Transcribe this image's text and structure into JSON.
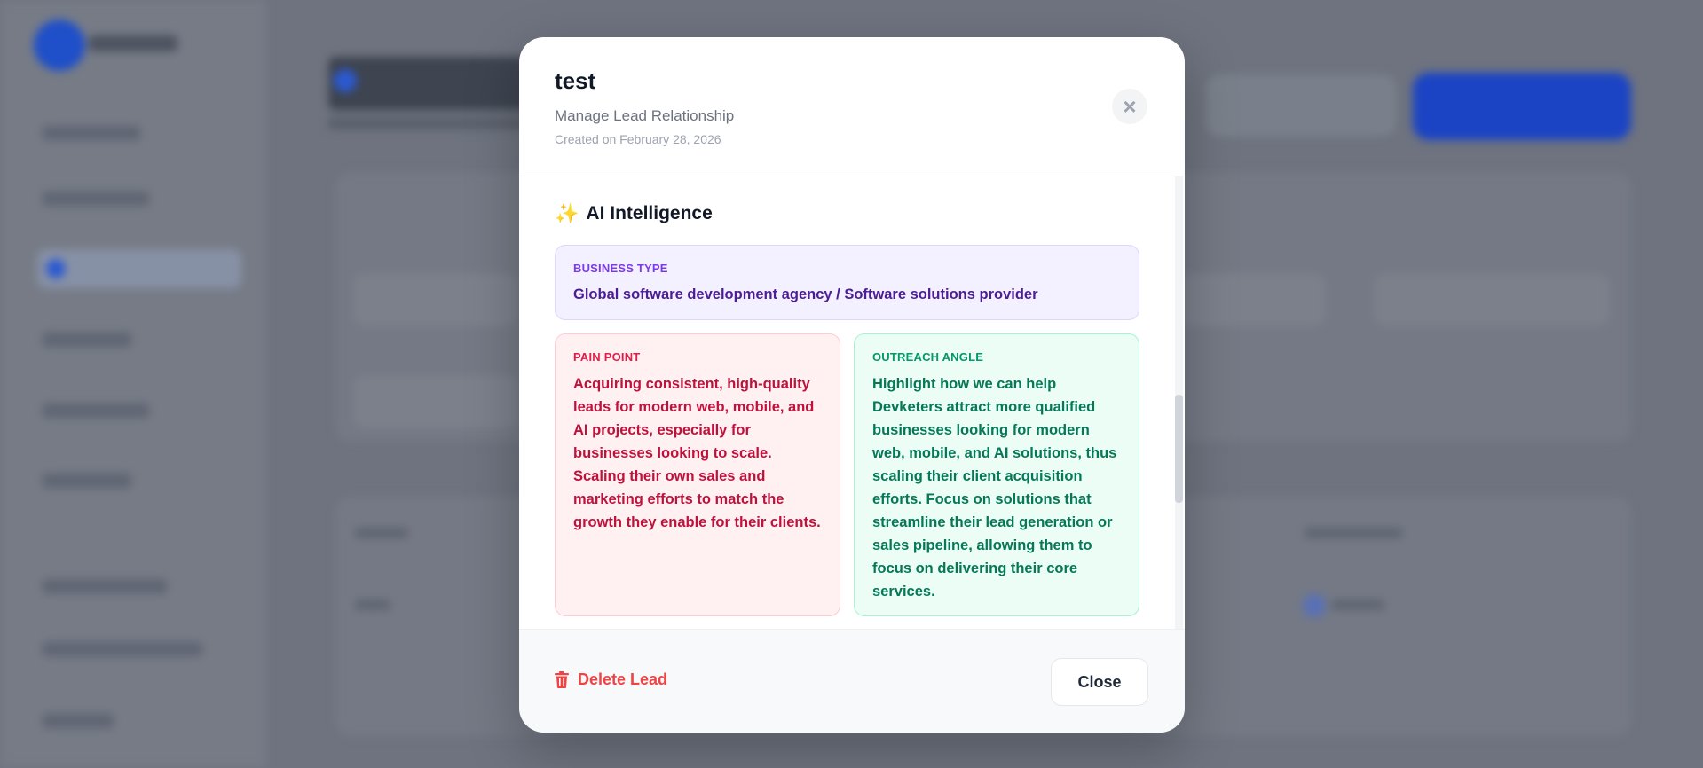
{
  "modal": {
    "title": "test",
    "subtitle": "Manage Lead Relationship",
    "created": "Created on February 28, 2026",
    "close_icon": "close-icon"
  },
  "ai_section": {
    "icon": "sparkle-icon",
    "title": "AI Intelligence",
    "business_type": {
      "label": "BUSINESS TYPE",
      "value": "Global software development agency / Software solutions provider"
    },
    "pain_point": {
      "label": "PAIN POINT",
      "value": "Acquiring consistent, high-quality leads for modern web, mobile, and AI projects, especially for businesses looking to scale. Scaling their own sales and marketing efforts to match the growth they enable for their clients."
    },
    "outreach_angle": {
      "label": "OUTREACH ANGLE",
      "value": "Highlight how we can help Devketers attract more qualified businesses looking for modern web, mobile, and AI solutions, thus scaling their client acquisition efforts. Focus on solutions that streamline their lead generation or sales pipeline, allowing them to focus on delivering their core services."
    }
  },
  "footer": {
    "delete_label": "Delete Lead",
    "close_label": "Close"
  },
  "colors": {
    "danger": "#ef4444",
    "purple_accent": "#7c3aed",
    "green_accent": "#059669",
    "rose_accent": "#e11d48"
  }
}
